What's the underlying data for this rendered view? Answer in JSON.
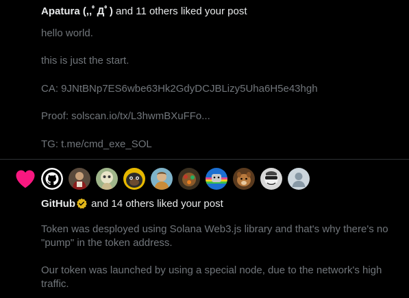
{
  "colors": {
    "background": "#000000",
    "primary_text": "#e7e9ea",
    "secondary_text": "#71767b",
    "divider": "#2f3336",
    "like_heart": "#f91880",
    "verified_badge": "#e2b719"
  },
  "notifications": [
    {
      "type": "like",
      "actor_name": "Apatura (,,ﾟДﾟ)",
      "summary": " and 11 others liked your post",
      "post_text": "hello world.\n\nthis is just the start.\n\nCA: 9JNtBNp7ES6wbe63Hk2GdyDCJBLizy5Uha6H5e43hgh\n\nProof: solscan.io/tx/L3hwmBXuFFo...\n\nTG: t.me/cmd_exe_SOL"
    },
    {
      "type": "like",
      "icon": "heart-icon",
      "actor_name": "GitHub",
      "actor_verified": true,
      "summary": " and 14 others liked your post",
      "post_text": "Token was desployed using Solana Web3.js library and that's why there's no \"pump\" in the token address.\n\nOur token was launched by using a special node, due to the network's high traffic.",
      "avatars": [
        "github-logo",
        "user-avatar",
        "user-avatar",
        "user-avatar",
        "user-avatar",
        "user-avatar",
        "user-avatar",
        "user-avatar",
        "user-avatar",
        "user-avatar",
        "default-avatar"
      ]
    }
  ]
}
